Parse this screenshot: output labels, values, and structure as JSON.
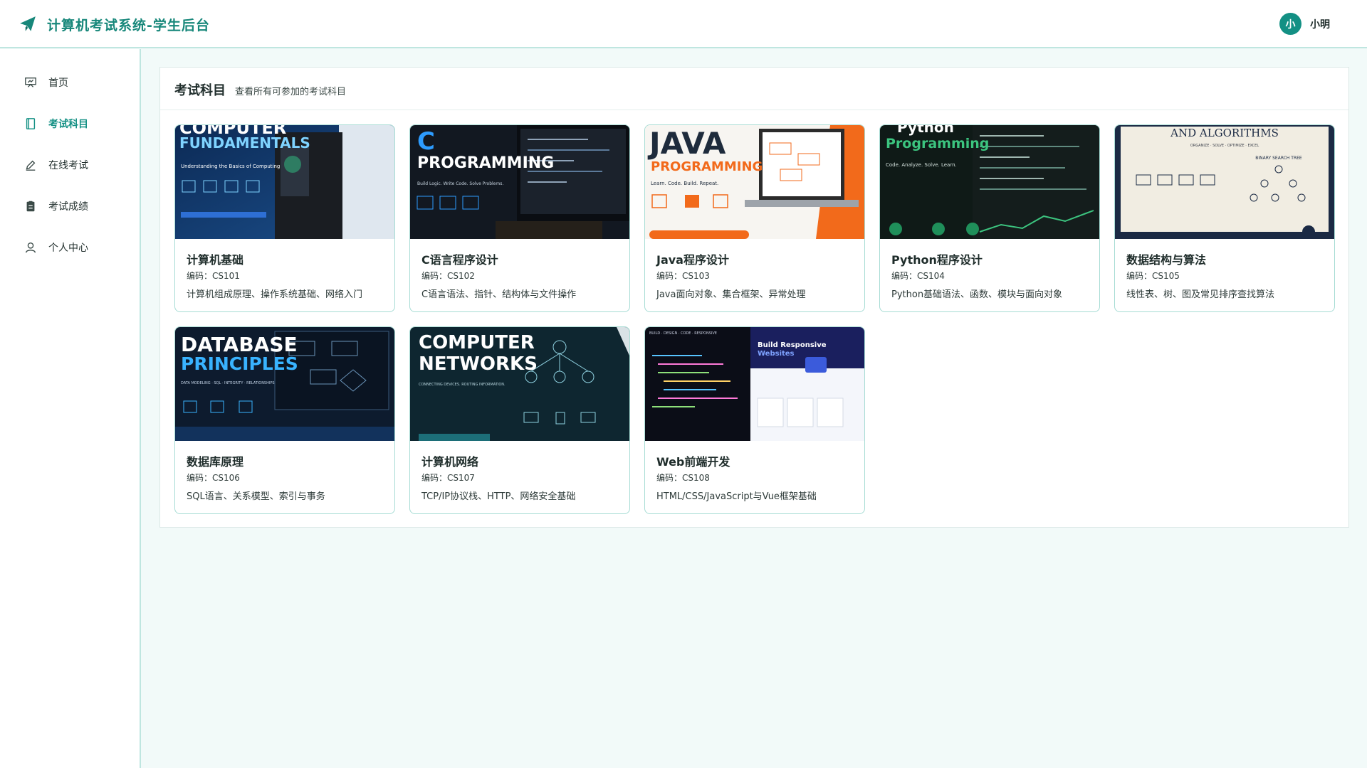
{
  "app": {
    "title": "计算机考试系统-学生后台",
    "brand_icon": "paper-plane-icon",
    "accent": "#139084"
  },
  "user": {
    "avatar_text": "小",
    "name": "小明"
  },
  "sidebar": {
    "items": [
      {
        "label": "首页",
        "icon": "presentation-icon",
        "active": false
      },
      {
        "label": "考试科目",
        "icon": "book-icon",
        "active": true
      },
      {
        "label": "在线考试",
        "icon": "pen-icon",
        "active": false
      },
      {
        "label": "考试成绩",
        "icon": "clipboard-icon",
        "active": false
      },
      {
        "label": "个人中心",
        "icon": "user-icon",
        "active": false
      }
    ]
  },
  "main": {
    "title": "考试科目",
    "subtitle": "查看所有可参加的考试科目",
    "courses": [
      {
        "title": "计算机基础",
        "code": "编码：CS101",
        "desc": "计算机组成原理、操作系统基础、网络入门",
        "cover": {
          "line1": "COMPUTER",
          "line2": "FUNDAMENTALS",
          "tagline": "Understanding the Basics of Computing"
        }
      },
      {
        "title": "C语言程序设计",
        "code": "编码：CS102",
        "desc": "C语言语法、指针、结构体与文件操作",
        "cover": {
          "line1": "C",
          "line2": "PROGRAMMING",
          "tagline": "Build Logic. Write Code. Solve Problems."
        }
      },
      {
        "title": "Java程序设计",
        "code": "编码：CS103",
        "desc": "Java面向对象、集合框架、异常处理",
        "cover": {
          "line1": "JAVA",
          "line2": "PROGRAMMING",
          "tagline": "Learn. Code. Build. Repeat."
        }
      },
      {
        "title": "Python程序设计",
        "code": "编码：CS104",
        "desc": "Python基础语法、函数、模块与面向对象",
        "cover": {
          "line1": "Python",
          "line2": "Programming",
          "tagline": "Code. Analyze. Solve. Learn."
        }
      },
      {
        "title": "数据结构与算法",
        "code": "编码：CS105",
        "desc": "线性表、树、图及常见排序查找算法",
        "cover": {
          "line1": "AND ALGORITHMS",
          "line2": "ORGANIZE · SOLVE · OPTIMIZE · EXCEL",
          "tagline": "BINARY SEARCH TREE"
        }
      },
      {
        "title": "数据库原理",
        "code": "编码：CS106",
        "desc": "SQL语言、关系模型、索引与事务",
        "cover": {
          "line1": "DATABASE",
          "line2": "PRINCIPLES",
          "tagline": "DATA MODELING · SQL · INTEGRITY · RELATIONSHIPS"
        }
      },
      {
        "title": "计算机网络",
        "code": "编码：CS107",
        "desc": "TCP/IP协议栈、HTTP、网络安全基础",
        "cover": {
          "line1": "COMPUTER",
          "line2": "NETWORKS",
          "tagline": "CONNECTING DEVICES. ROUTING INFORMATION."
        }
      },
      {
        "title": "Web前端开发",
        "code": "编码：CS108",
        "desc": "HTML/CSS/JavaScript与Vue框架基础",
        "cover": {
          "line1": "Build Responsive",
          "line2": "Websites",
          "tagline": "BUILD · DESIGN · CODE · RESPONSIVE"
        }
      }
    ]
  }
}
